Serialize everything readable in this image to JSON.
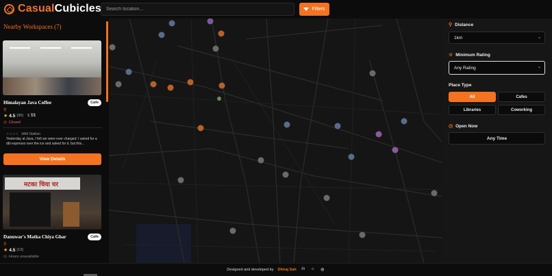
{
  "app": {
    "brand_part1": "Casual",
    "brand_part2": "Cubicles",
    "accent": "#f47320"
  },
  "header": {
    "search_placeholder": "Search location...",
    "filters_label": "Filters"
  },
  "sidebar": {
    "title": "Nearby Workspaces (7)",
    "cards": [
      {
        "name": "Himalayan Java Coffee",
        "type": "Cafe",
        "rating": "4.5",
        "count": "(95)",
        "price": "$$",
        "status": "Closed",
        "review_author": "3AM Stallion",
        "review_stars": "☆☆☆☆",
        "review_text": "Yesterday at Java, I felt we were over charged. I asked for a dbl espresso over the ice and asked for it. but this...",
        "button": "View Details"
      },
      {
        "name": "Danuwar's Matka Chiya Ghar",
        "type": "Cafe",
        "rating": "4.5",
        "count": "(13)",
        "status": "Hours unavailable",
        "sign": "मटका चिया घर"
      }
    ]
  },
  "filters": {
    "distance_label": "Distance",
    "distance_value": "1km",
    "min_rating_label": "Minimum Rating",
    "min_rating_value": "Any Rating",
    "place_type_label": "Place Type",
    "place_types": [
      "All",
      "Cafes",
      "Libraries",
      "Coworking"
    ],
    "selected_place_type": "All",
    "open_now_label": "Open Now",
    "open_now_value": "Any Time"
  },
  "footer": {
    "prefix": "Designed and developed by",
    "developer": "Dhiraj Sah"
  }
}
